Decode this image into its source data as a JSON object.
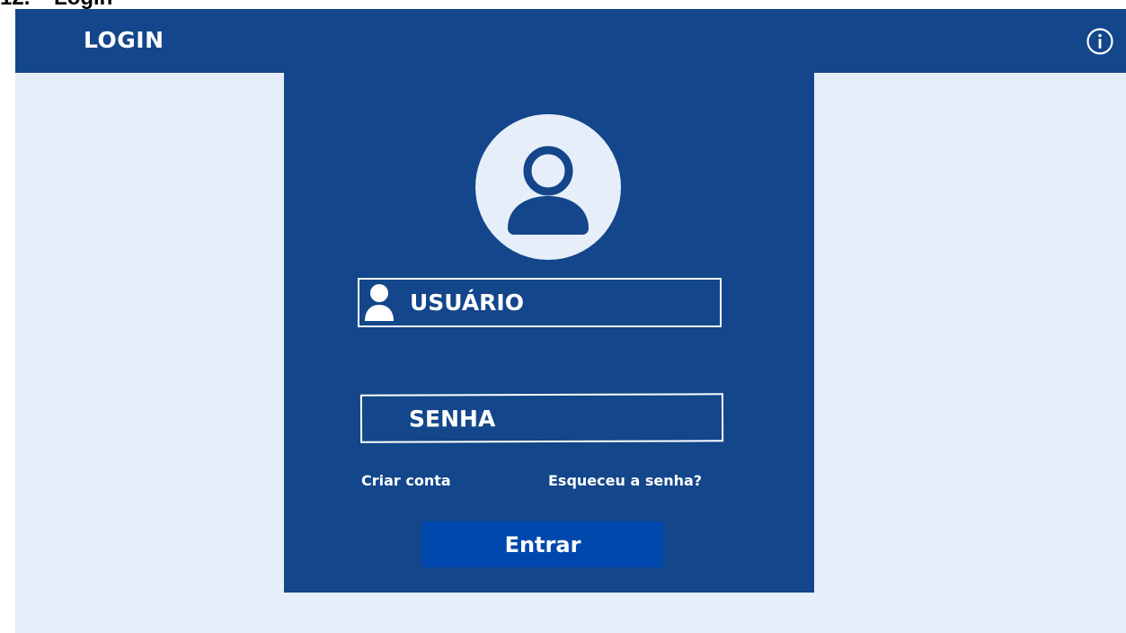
{
  "page": {
    "caption": "12.    Login"
  },
  "header": {
    "title": "LOGIN",
    "info_icon": "info-circle-icon"
  },
  "login": {
    "avatar_icon": "user-avatar-icon",
    "username_label": "USUÁRIO",
    "username_icon": "user-icon",
    "password_label": "SENHA",
    "create_account_link": "Criar conta",
    "forgot_password_link": "Esqueceu a senha?",
    "submit_label": "Entrar"
  },
  "colors": {
    "header_bg": "#13468a",
    "panel_bg": "#13468a",
    "page_bg": "#e6eef9",
    "button_bg": "#0048ad",
    "text": "#ffffff"
  }
}
